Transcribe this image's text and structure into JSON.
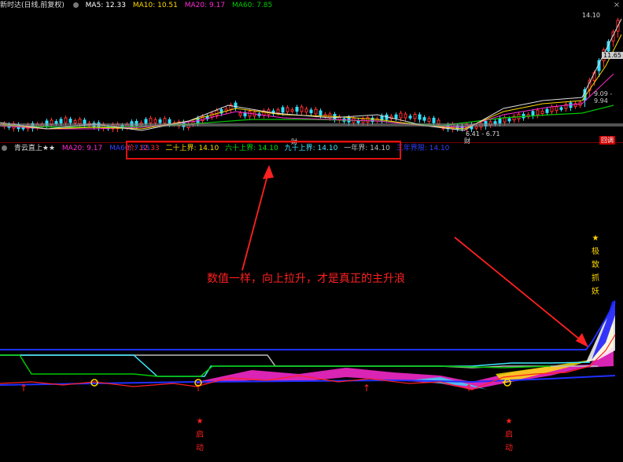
{
  "top_legend": {
    "stock_name": "新时达(日线,前复权)",
    "ma5": "MA5: 12.33",
    "ma10": "MA10: 10.51",
    "ma20": "MA20: 9.17",
    "ma60": "MA60: 7.85"
  },
  "price_labels": {
    "high": "14.10",
    "low": "6.41 - 6.71",
    "mid1": "11.65",
    "mid2": "9.09 - 9.94",
    "marker1": "财",
    "marker2": "财",
    "corner": "回调"
  },
  "bottom_legend": {
    "indicator": "青云直上★★",
    "ma20": "MA20: 9.17",
    "ma60": "MA60: 7.85"
  },
  "callout": {
    "price": "价: 12.33",
    "twenty": "二十上界: 14.10",
    "sixty": "六十上界: 14.10",
    "ninety": "九十上界: 14.10",
    "yearly": "一年界: 14.10",
    "tri": "三年界限: 14.10"
  },
  "annotation": "数值一样，向上拉升，才是真正的主升浪",
  "fire_text": [
    "★",
    "极",
    "致",
    "抓",
    "妖"
  ],
  "start_marks": [
    "★",
    "启",
    "动"
  ],
  "colors": {
    "ma5": "#ffffff",
    "ma10": "#ffd800",
    "ma20": "#ff2ad4",
    "ma60": "#00c800",
    "annotation": "#ff2020"
  }
}
